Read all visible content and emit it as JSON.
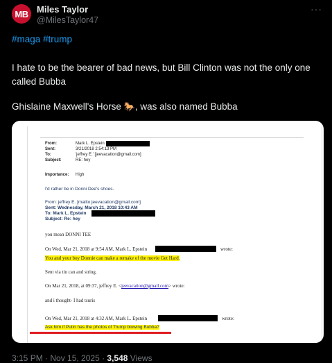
{
  "author": {
    "avatar_text": "MB",
    "name": "Miles Taylor",
    "handle": "@MilesTaylor47"
  },
  "more_icon": "···",
  "tweet": {
    "hashtags": "#maga #trump",
    "paragraph1": "I hate to be the bearer of bad news, but Bill Clinton was not the only one called Bubba",
    "paragraph2_before": "Ghislaine Maxwell's Horse ",
    "horse_icon": "🐎",
    "paragraph2_after": ", was also named Bubba"
  },
  "document": {
    "from_label": "From:",
    "from_value": "Mark L. Epstein",
    "sent_label": "Sent:",
    "sent_value": "3/21/2018 2:54:13 PM",
    "to_label": "To:",
    "to_value": "'jeffrey E.' [jeevacation@gmail.com]",
    "subject_label": "Subject:",
    "subject_value": "RE: hey",
    "importance_label": "Importance:",
    "importance_value": "High",
    "shoes_line": "I'd rather be in Donni Dee's shoes.",
    "from2": "From: jeffrey E. [mailto:jeevacation@gmail.com]",
    "sent2": "Sent: Wednesday, March 21, 2018 10:43 AM",
    "to2": "To: Mark L. Epstein",
    "subject2": "Subject: Re: hey",
    "donni": "you mean DONNI TEE",
    "on1_before": "On Wed, Mar 21, 2018 at 9:54 AM, Mark L. Epstein",
    "on1_after": "wrote:",
    "remake": "You and your boy Donnie can make a remake of the movie Get Hard.",
    "tin": "Sent via tin can and string.",
    "on2_before": "On Mar 21, 2018, at 09:37, jeffrey E. <",
    "on2_link": "jeevacation@gmail.com",
    "on2_after": "> wrote:",
    "tsuris": "and i thought- I had tsuris",
    "on3_before": "On Wed, Mar 21, 2018 at 4:32 AM, Mark L. Epstein",
    "on3_after": "wrote:",
    "putin": "Ask him if Putin has the photos of Trump blowing Bubba?"
  },
  "footer": {
    "time": "3:15 PM · Nov 15, 2025 · ",
    "views_count": "3,548",
    "views_label": " Views"
  }
}
